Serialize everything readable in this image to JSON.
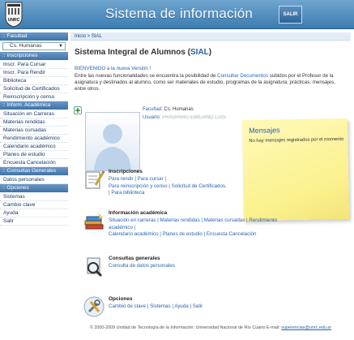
{
  "header": {
    "title": "Sistema de información",
    "logout_label": "SALIR",
    "logo_text": "UNRC"
  },
  "sidebar": {
    "facultad_header": ":: Facultad",
    "facultad_selected": "Cs. Humanas",
    "inscripciones_header": ":: Inscripciones",
    "inscripciones_items": [
      "Inscr. Para Cursar",
      "Inscr. Para Rendir",
      "Biblioteca",
      "Solicitud de Certificados",
      "Reinscripción y censo"
    ],
    "academica_header": ":: Inform. Académica",
    "academica_items": [
      "Situación en Carreras",
      "Materias rendidas",
      "Materias cursadas",
      "Rendimiento académico",
      "Calendario académico",
      "Planes de estudio",
      "Encuesta Cancelación"
    ],
    "consultas_header": ":: Consultas Generales",
    "consultas_items": [
      "Datos personales"
    ],
    "opciones_header": ":: Opciones",
    "opciones_items": [
      "Sistemas",
      "Cambio clave",
      "Ayuda",
      "Salir"
    ]
  },
  "main": {
    "breadcrumb_home": "Inicio",
    "breadcrumb_sep": " > ",
    "breadcrumb_current": "SIAL",
    "title_prefix": "Sistema Integral de Alumnos (",
    "title_accent": "SIAL",
    "title_suffix": ")",
    "welcome": "BIENVENIDO a la nueva Versión !",
    "intro_before": "Entre las nuevas funcionalidades se encuentra la posibilidad de ",
    "intro_link": "Consultar Documentos",
    "intro_after": " subidos por el Profesor de la asignatura y destinados al alumno, como ser materiales de estudio, programas de la asignatura, prácticas, mensajes, entre otros.",
    "profile": {
      "facultad_label": "Facultad:",
      "facultad_value": "Cs. Humanas",
      "usuario_label": "Usuario:",
      "usuario_value": "PRADPARO EMILIANO LUIS"
    },
    "messages": {
      "title": "Mensajes",
      "text": "No hay mensajes registrados por el momento"
    },
    "sections": {
      "inscripciones": {
        "title": "Inscripciones",
        "links": [
          "Para rendir",
          "Para cursar",
          "Para reinscripción y censo",
          "Solicitud de Certificados.",
          "Para biblioteca"
        ]
      },
      "academica": {
        "title": "Información académica",
        "links": [
          "Situación en carreras",
          "Materias rendidas",
          "Materias cursadas",
          "Rendimiento académico",
          "Calendario académico",
          "Planes de estudio",
          "Encuesta Cancelación"
        ]
      },
      "consultas": {
        "title": "Consultas generales",
        "links": [
          "Consulta de datos personales"
        ]
      },
      "opciones": {
        "title": "Opciones",
        "links": [
          "Cambio de clave",
          "Sistemas",
          "Ayuda",
          "Salir"
        ]
      }
    },
    "footer_text": "© 2000-2009 Unidad de Tecnología de la Información; Universidad Nacional de Río Cuarto E-mail: ",
    "footer_email": "superencias@unrc.edu.ar"
  },
  "colors": {
    "header": "#3d7bb0",
    "sidebar_header": "#3f72a8",
    "link": "#2a63b0",
    "sticky": "#fbf18e"
  }
}
